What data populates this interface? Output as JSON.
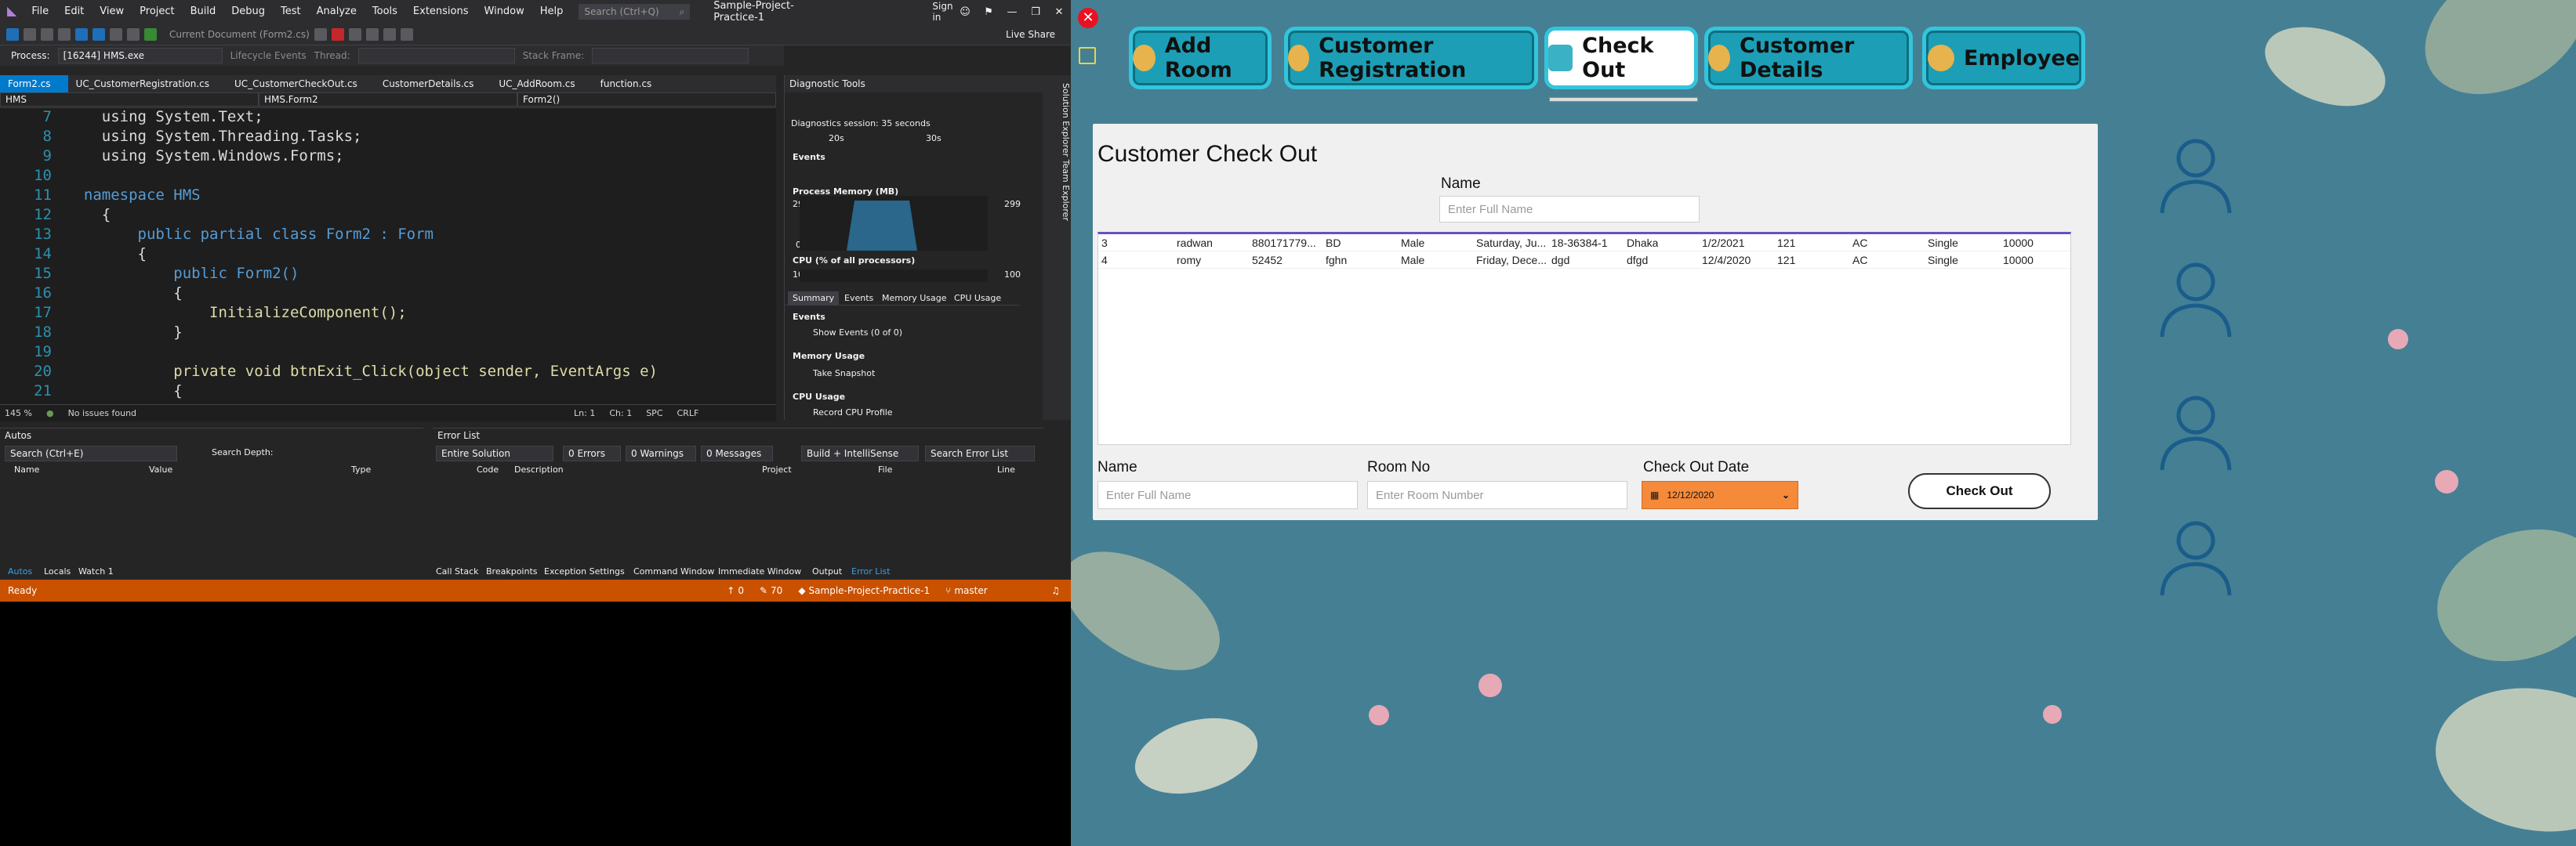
{
  "vs": {
    "menu": [
      "File",
      "Edit",
      "View",
      "Project",
      "Build",
      "Debug",
      "Test",
      "Analyze",
      "Tools",
      "Extensions",
      "Window",
      "Help"
    ],
    "search_placeholder": "Search (Ctrl+Q)",
    "project_title": "Sample-Project-Practice-1",
    "sign_in": "Sign in",
    "live_share": "Live Share",
    "current_document": "Current Document (Form2.cs)",
    "process_label": "Process:",
    "process_value": "[16244] HMS.exe",
    "lifecycle_events": "Lifecycle Events",
    "thread_label": "Thread:",
    "stack_frame_label": "Stack Frame:",
    "tabs": [
      "Form2.cs",
      "UC_CustomerRegistration.cs",
      "UC_CustomerCheckOut.cs",
      "CustomerDetails.cs",
      "UC_AddRoom.cs",
      "function.cs"
    ],
    "nav": {
      "project": "HMS",
      "class": "HMS.Form2",
      "member": "Form2()"
    },
    "code_lines": [
      {
        "n": "7",
        "t": "    using System.Text;"
      },
      {
        "n": "8",
        "t": "    using System.Threading.Tasks;"
      },
      {
        "n": "9",
        "t": "    using System.Windows.Forms;"
      },
      {
        "n": "10",
        "t": ""
      },
      {
        "n": "11",
        "t": "  namespace HMS"
      },
      {
        "n": "12",
        "t": "    {"
      },
      {
        "n": "13",
        "t": "        public partial class Form2 : Form"
      },
      {
        "n": "14",
        "t": "        {"
      },
      {
        "n": "15",
        "t": "            public Form2()"
      },
      {
        "n": "16",
        "t": "            {"
      },
      {
        "n": "17",
        "t": "                InitializeComponent();"
      },
      {
        "n": "18",
        "t": "            }"
      },
      {
        "n": "19",
        "t": ""
      },
      {
        "n": "20",
        "t": "            private void btnExit_Click(object sender, EventArgs e)"
      },
      {
        "n": "21",
        "t": "            {"
      }
    ],
    "editor_status": {
      "zoom": "145 %",
      "issues": "No issues found",
      "ln": "Ln: 1",
      "ch": "Ch: 1",
      "spc": "SPC",
      "crlf": "CRLF"
    },
    "diag": {
      "title": "Diagnostic Tools",
      "session": "Diagnostics session: 35 seconds",
      "t20": "20s",
      "t30": "30s",
      "events": "Events",
      "process_memory": "Process Memory (MB)",
      "mem_max": "299",
      "mem_min": "0",
      "cpu": "CPU (% of all processors)",
      "cpu_max": "100",
      "tabs": [
        "Summary",
        "Events",
        "Memory Usage",
        "CPU Usage"
      ],
      "events_section": "Events",
      "show_events": "Show Events (0 of 0)",
      "memory_section": "Memory Usage",
      "take_snapshot": "Take Snapshot",
      "cpu_section": "CPU Usage",
      "record_cpu": "Record CPU Profile"
    },
    "side_tabs": "Solution Explorer   Team Explorer",
    "autos": {
      "title": "Autos",
      "search_placeholder": "Search (Ctrl+E)",
      "search_depth": "Search Depth:",
      "cols": [
        "Name",
        "Value",
        "Type"
      ],
      "bottom_tabs": [
        "Autos",
        "Locals",
        "Watch 1"
      ]
    },
    "errors": {
      "title": "Error List",
      "scope": "Entire Solution",
      "errors": "0 Errors",
      "warnings": "0 Warnings",
      "messages": "0 Messages",
      "build": "Build + IntelliSense",
      "search_placeholder": "Search Error List",
      "cols": [
        "Code",
        "Description",
        "Project",
        "File",
        "Line"
      ],
      "bottom_tabs": [
        "Call Stack",
        "Breakpoints",
        "Exception Settings",
        "Command Window",
        "Immediate Window",
        "Output",
        "Error List"
      ]
    },
    "statusbar": {
      "ready": "Ready",
      "up": "0",
      "pencil": "70",
      "project": "Sample-Project-Practice-1",
      "branch": "master"
    }
  },
  "hms": {
    "close": "✕",
    "nav_tabs": [
      {
        "label": "Add Room",
        "active": false
      },
      {
        "label": "Customer Registration",
        "active": false
      },
      {
        "label": "Check Out",
        "active": true
      },
      {
        "label": "Customer Details",
        "active": false
      },
      {
        "label": "Employee",
        "active": false
      }
    ],
    "title": "Customer Check Out",
    "search": {
      "label": "Name",
      "placeholder": "Enter Full Name"
    },
    "grid_rows": [
      [
        "3",
        "radwan",
        "880171779...",
        "BD",
        "Male",
        "Saturday, Ju...",
        "18-36384-1",
        "Dhaka",
        "1/2/2021",
        "121",
        "AC",
        "Single",
        "10000"
      ],
      [
        "4",
        "romy",
        "52452",
        "fghn",
        "Male",
        "Friday, Dece...",
        "dgd",
        "dfgd",
        "12/4/2020",
        "121",
        "AC",
        "Single",
        "10000"
      ]
    ],
    "bottom": {
      "name_label": "Name",
      "name_placeholder": "Enter Full Name",
      "room_label": "Room No",
      "room_placeholder": "Enter Room Number",
      "date_label": "Check Out Date",
      "date_value": "12/12/2020",
      "checkout_button": "Check Out"
    },
    "colors": {
      "background": "#457f94",
      "tab_fill": "#1c9fb6",
      "tab_border": "#33c5dc",
      "date_picker": "#f58a3a"
    }
  }
}
